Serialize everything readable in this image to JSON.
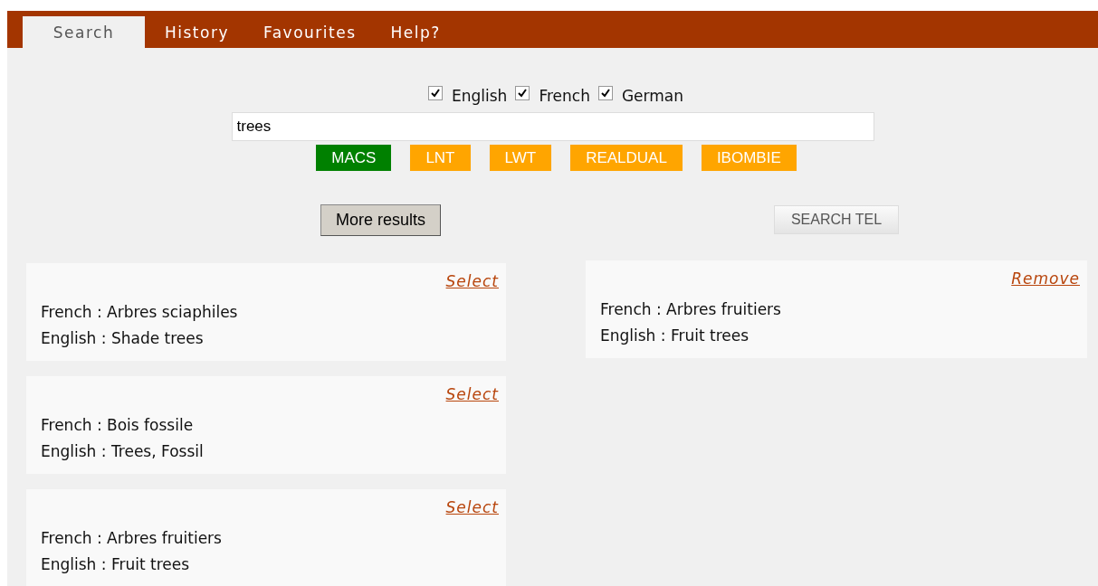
{
  "tabs": [
    {
      "label": "Search",
      "selected": true
    },
    {
      "label": "History",
      "selected": false
    },
    {
      "label": "Favourites",
      "selected": false
    },
    {
      "label": "Help?",
      "selected": false
    }
  ],
  "languages": [
    {
      "label": "English",
      "checked": true
    },
    {
      "label": "French",
      "checked": true
    },
    {
      "label": "German",
      "checked": true
    }
  ],
  "search": {
    "value": "trees"
  },
  "sources": [
    {
      "label": "MACS",
      "selected": true
    },
    {
      "label": "LNT",
      "selected": false
    },
    {
      "label": "LWT",
      "selected": false
    },
    {
      "label": "REALDUAL",
      "selected": false
    },
    {
      "label": "IBOMBIE",
      "selected": false
    }
  ],
  "more_button": "More results",
  "search_tel_button": "SEARCH TEL",
  "results": [
    {
      "action": "Select",
      "lines": [
        "French : Arbres sciaphiles",
        "English : Shade trees"
      ]
    },
    {
      "action": "Select",
      "lines": [
        "French : Bois fossile",
        "English : Trees, Fossil"
      ]
    },
    {
      "action": "Select",
      "lines": [
        "French : Arbres fruitiers",
        "English : Fruit trees"
      ]
    }
  ],
  "selected_results": [
    {
      "action": "Remove",
      "lines": [
        "French : Arbres fruitiers",
        "English : Fruit trees"
      ]
    }
  ]
}
